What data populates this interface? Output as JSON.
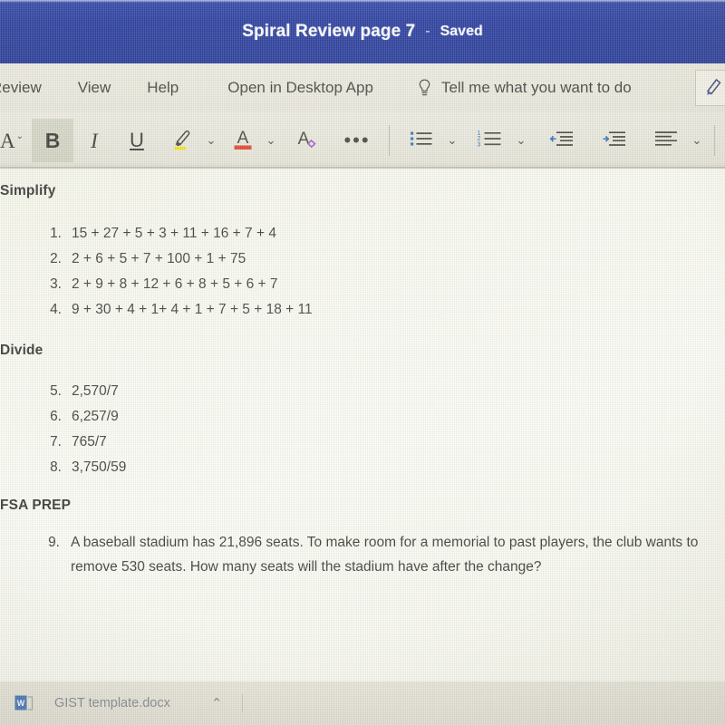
{
  "titlebar": {
    "document_title": "Spiral Review page 7",
    "separator": "-",
    "save_status": "Saved"
  },
  "menubar": {
    "items": [
      {
        "label": "Review"
      },
      {
        "label": "View"
      },
      {
        "label": "Help"
      },
      {
        "label": "Open in Desktop App"
      }
    ],
    "tell_me": {
      "icon": "lightbulb-icon",
      "label": "Tell me what you want to do"
    },
    "editing_button": {
      "icon": "pen-editing-icon"
    }
  },
  "toolbar": {
    "buttons": [
      {
        "name": "font-size-button",
        "icon": "font-size-A-icon",
        "glyph": "A",
        "has_chevron": true,
        "active": false
      },
      {
        "name": "bold-button",
        "icon": "bold-icon",
        "glyph": "B",
        "has_chevron": false,
        "active": true
      },
      {
        "name": "italic-button",
        "icon": "italic-icon",
        "glyph": "I",
        "has_chevron": false,
        "active": false
      },
      {
        "name": "underline-button",
        "icon": "underline-icon",
        "glyph": "U",
        "has_chevron": false,
        "active": false
      },
      {
        "name": "highlight-button",
        "icon": "highlighter-icon",
        "glyph": "",
        "has_chevron": true,
        "active": false
      },
      {
        "name": "font-color-button",
        "icon": "font-color-A-icon",
        "glyph": "A",
        "has_chevron": true,
        "active": false
      },
      {
        "name": "clear-formatting-button",
        "icon": "clear-formatting-icon",
        "glyph": "A",
        "has_chevron": false,
        "active": false
      },
      {
        "name": "more-options-button",
        "icon": "ellipsis-icon",
        "glyph": "...",
        "has_chevron": false,
        "active": false
      },
      {
        "name": "bullet-list-button",
        "icon": "bulleted-list-icon",
        "glyph": "",
        "has_chevron": true,
        "active": false
      },
      {
        "name": "numbered-list-button",
        "icon": "numbered-list-icon",
        "glyph": "",
        "has_chevron": true,
        "active": false
      },
      {
        "name": "decrease-indent-button",
        "icon": "decrease-indent-icon",
        "glyph": "",
        "has_chevron": false,
        "active": false
      },
      {
        "name": "increase-indent-button",
        "icon": "increase-indent-icon",
        "glyph": "",
        "has_chevron": false,
        "active": false
      },
      {
        "name": "align-button",
        "icon": "align-left-icon",
        "glyph": "",
        "has_chevron": true,
        "active": false
      },
      {
        "name": "styles-button",
        "icon": "format-painter-A-icon",
        "glyph": "",
        "has_chevron": true,
        "active": false
      }
    ],
    "colors": {
      "highlight": "#f7e400",
      "font_color": "#e03b20",
      "clear_format_accent": "#9a54c4",
      "list_accent": "#2e6fb5",
      "indent_accent": "#2e6fb5"
    }
  },
  "document": {
    "sections": [
      {
        "heading": "Simplify",
        "items": [
          {
            "number": "1.",
            "text": "15 + 27 + 5 + 3 + 11 + 16 + 7 + 4"
          },
          {
            "number": "2.",
            "text": "2 + 6 + 5 + 7 + 100 + 1 + 75"
          },
          {
            "number": "3.",
            "text": "2 + 9 + 8 + 12 + 6 + 8 + 5 + 6 + 7"
          },
          {
            "number": "4.",
            "text": "9 + 30 + 4 + 1+ 4 + 1 + 7 + 5 + 18 + 11"
          }
        ]
      },
      {
        "heading": "Divide",
        "items": [
          {
            "number": "5.",
            "text": "2,570/7"
          },
          {
            "number": "6.",
            "text": "6,257/9"
          },
          {
            "number": "7.",
            "text": "765/7"
          },
          {
            "number": "8.",
            "text": "3,750/59"
          }
        ]
      },
      {
        "heading": "FSA PREP",
        "items": [
          {
            "number": "9.",
            "text": "A baseball stadium has 21,896 seats.  To make room for a memorial to past players, the club wants to remove 530 seats.  How many seats will the stadium have after the change?"
          }
        ]
      }
    ]
  },
  "taskbar": {
    "file_icon": "word-document-icon",
    "file_name": "GIST template.docx",
    "expand_icon": "chevron-up-icon"
  },
  "colors": {
    "titlebar_blue": "#20349c",
    "ribbon_bg": "#eeece2",
    "page_bg": "#fbfbf3",
    "text": "#33332f"
  }
}
